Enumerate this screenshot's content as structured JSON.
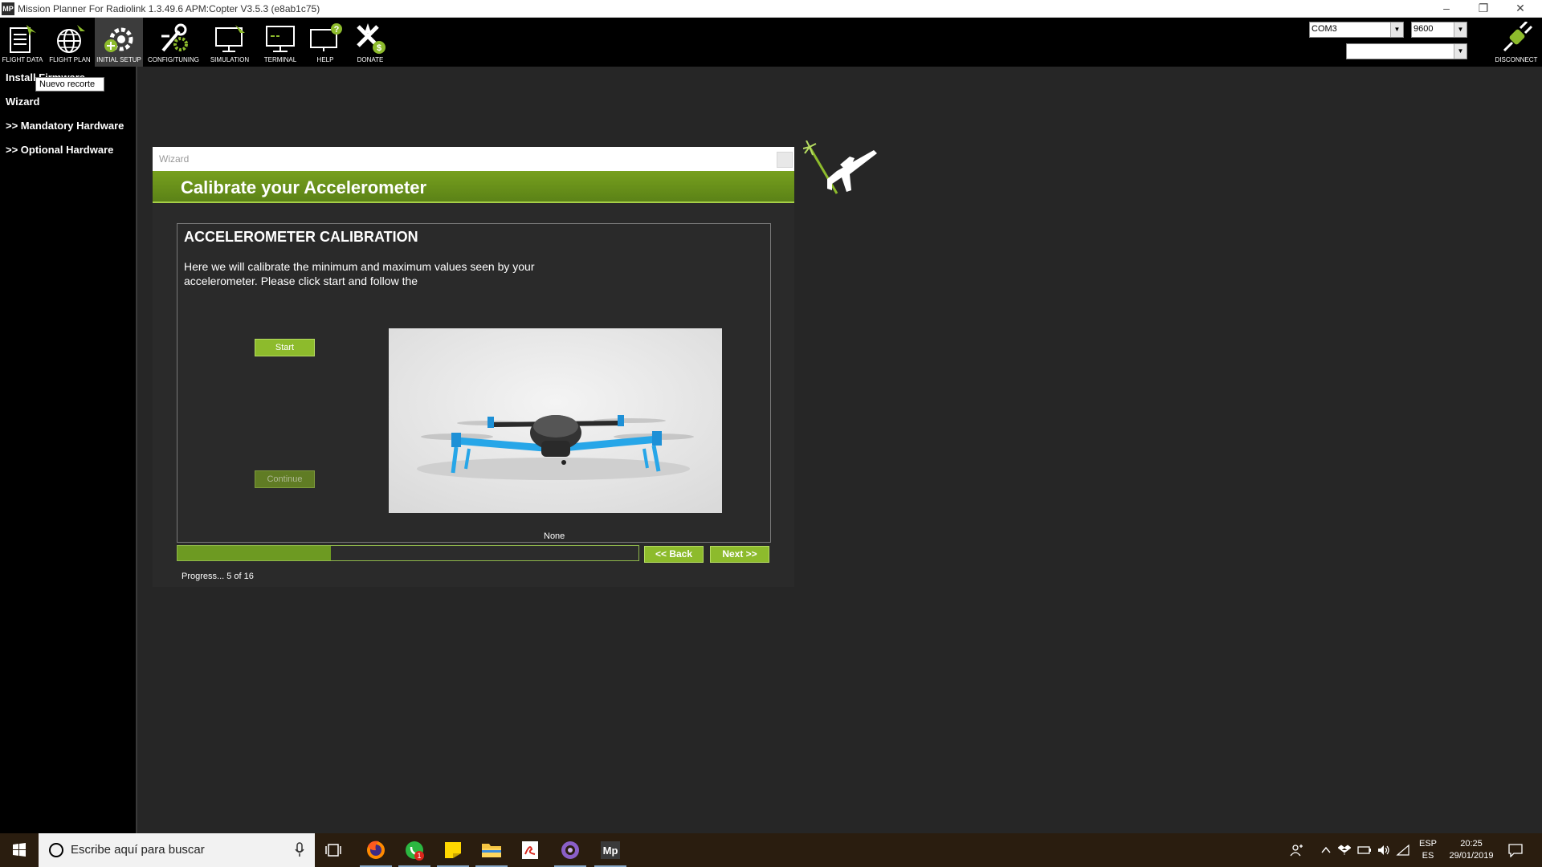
{
  "window": {
    "title": "Mission Planner For Radiolink 1.3.49.6 APM:Copter V3.5.3 (e8ab1c75)",
    "app_icon_text": "MP"
  },
  "toolbar": {
    "items": [
      {
        "label": "FLIGHT DATA",
        "icon": "flight-data-icon"
      },
      {
        "label": "FLIGHT PLAN",
        "icon": "flight-plan-icon"
      },
      {
        "label": "INITIAL SETUP",
        "icon": "initial-setup-icon",
        "active": true
      },
      {
        "label": "CONFIG/TUNING",
        "icon": "config-tuning-icon"
      },
      {
        "label": "SIMULATION",
        "icon": "simulation-icon"
      },
      {
        "label": "TERMINAL",
        "icon": "terminal-icon"
      },
      {
        "label": "HELP",
        "icon": "help-icon"
      },
      {
        "label": "DONATE",
        "icon": "donate-icon"
      }
    ],
    "port_value": "COM3",
    "baud_value": "9600",
    "profile_value": "",
    "disconnect_label": "DISCONNECT"
  },
  "sidebar": {
    "items": [
      {
        "label": "Install Firmware"
      },
      {
        "label": "Wizard"
      },
      {
        "label": ">> Mandatory Hardware"
      },
      {
        "label": ">> Optional Hardware"
      }
    ],
    "tooltip": "Nuevo recorte"
  },
  "wizard": {
    "window_title": "Wizard",
    "header": "Calibrate your Accelerometer",
    "panel_title": "ACCELEROMETER CALIBRATION",
    "description": "Here we will calibrate the minimum and maximum values seen by your accelerometer. Please click start and follow the",
    "start_label": "Start",
    "continue_label": "Continue",
    "status_label": "None",
    "progress_fraction": 0.333,
    "back_label": "<< Back",
    "next_label": "Next >>",
    "progress_text": "Progress... 5 of 16"
  },
  "taskbar": {
    "search_placeholder": "Escribe aquí para buscar",
    "apps": [
      "task-view-icon",
      "firefox-icon",
      "whatsapp-icon",
      "sticky-notes-icon",
      "file-explorer-icon",
      "pdf-icon",
      "media-icon",
      "mission-planner-icon"
    ],
    "whatsapp_badge": "1",
    "mp_icon_text": "Mp",
    "lang_top": "ESP",
    "lang_bottom": "ES",
    "time": "20:25",
    "date": "29/01/2019"
  },
  "colors": {
    "accent_green": "#8dbb2c",
    "header_green": "#5b8217",
    "background": "#262626"
  }
}
